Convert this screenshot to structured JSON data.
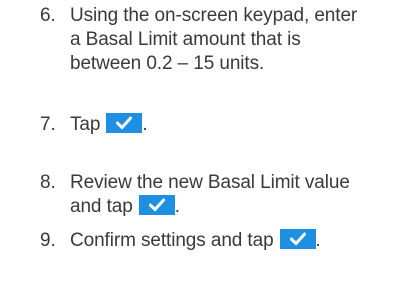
{
  "steps": [
    {
      "number": "6.",
      "lines": [
        "Using the on-screen keypad, enter",
        "a Basal Limit amount that is",
        "between 0.2 – 15 units."
      ]
    },
    {
      "number": "7.",
      "text": "Tap",
      "suffix": "."
    },
    {
      "number": "8.",
      "line1": "Review the new Basal Limit value",
      "line2": "and tap",
      "suffix": "."
    },
    {
      "number": "9.",
      "text": "Confirm settings and tap",
      "suffix": "."
    }
  ],
  "icons": {
    "confirm_button": "checkmark-icon",
    "button_color": "#1e8fe1",
    "check_color": "#ffffff"
  }
}
